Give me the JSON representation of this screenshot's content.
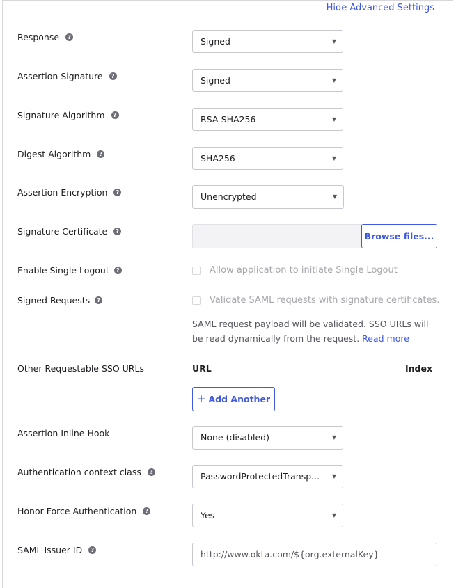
{
  "header": {
    "hide_advanced": "Hide Advanced Settings"
  },
  "fields": {
    "response": {
      "label": "Response",
      "value": "Signed"
    },
    "assertion_signature": {
      "label": "Assertion Signature",
      "value": "Signed"
    },
    "signature_algorithm": {
      "label": "Signature Algorithm",
      "value": "RSA-SHA256"
    },
    "digest_algorithm": {
      "label": "Digest Algorithm",
      "value": "SHA256"
    },
    "assertion_encryption": {
      "label": "Assertion Encryption",
      "value": "Unencrypted"
    },
    "signature_certificate": {
      "label": "Signature Certificate",
      "button": "Browse files..."
    },
    "single_logout": {
      "label": "Enable Single Logout",
      "checkbox_label": "Allow application to initiate Single Logout"
    },
    "signed_requests": {
      "label": "Signed Requests",
      "checkbox_label": "Validate SAML requests with signature certificates.",
      "note": "SAML request payload will be validated. SSO URLs will be read dynamically from the request.",
      "note_link": "Read more"
    },
    "other_sso": {
      "label": "Other Requestable SSO URLs",
      "col_url": "URL",
      "col_index": "Index",
      "add_button": "Add Another"
    },
    "inline_hook": {
      "label": "Assertion Inline Hook",
      "value": "None (disabled)"
    },
    "auth_context": {
      "label": "Authentication context class",
      "value": "PasswordProtectedTransp..."
    },
    "force_auth": {
      "label": "Honor Force Authentication",
      "value": "Yes"
    },
    "issuer_id": {
      "label": "SAML Issuer ID",
      "value": "http://www.okta.com/${org.externalKey}"
    }
  },
  "icons": {
    "help": "?",
    "caret": "▼",
    "plus": "+"
  },
  "colors": {
    "accent": "#3f59e4",
    "help_icon": "#6e6e78"
  }
}
